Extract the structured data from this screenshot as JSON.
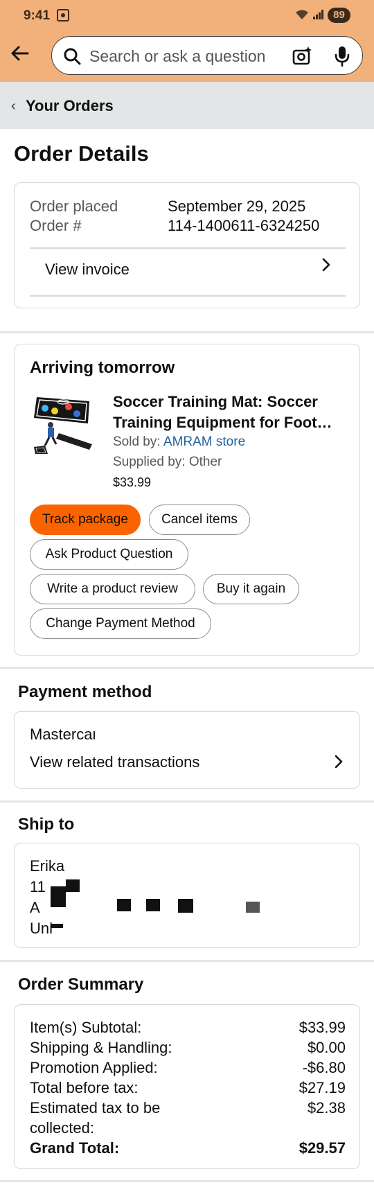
{
  "status_bar": {
    "time": "9:41",
    "battery": "89"
  },
  "search": {
    "placeholder": "Search or ask a question"
  },
  "breadcrumb": {
    "label": "Your Orders"
  },
  "page_title": "Order Details",
  "order_info": {
    "placed_label": "Order placed",
    "placed_value": "September 29, 2025",
    "number_label": "Order #",
    "number_value": "114-1400611-6324250",
    "invoice_label": "View invoice"
  },
  "shipment": {
    "status": "Arriving tomorrow",
    "product_title_line1": "Soccer Training Mat: Soccer",
    "product_title_line2": "Training Equipment for Foot…",
    "sold_by_label": "Sold by: ",
    "sold_by_store": "AMRAM store",
    "supplied_by": "Supplied by: Other",
    "price": "$33.99",
    "actions": {
      "track": "Track package",
      "cancel": "Cancel items",
      "ask": "Ask Product Question",
      "review": "Write a product review",
      "buy_again": "Buy it again",
      "change_payment": "Change Payment Method"
    }
  },
  "payment": {
    "heading": "Payment method",
    "card": "Mastercard",
    "transactions": "View related transactions"
  },
  "ship_to": {
    "heading": "Ship to",
    "line1": "Erika",
    "line2": "11",
    "line3": "A",
    "line4": "Uni"
  },
  "summary": {
    "heading": "Order Summary",
    "rows": [
      {
        "label": "Item(s) Subtotal:",
        "value": "$33.99"
      },
      {
        "label": "Shipping & Handling:",
        "value": "$0.00"
      },
      {
        "label": "Promotion Applied:",
        "value": "-$6.80"
      },
      {
        "label": "Total before tax:",
        "value": "$27.19"
      },
      {
        "label": "Estimated tax to be",
        "label2": "collected:",
        "value": "$2.38"
      },
      {
        "label": "Grand Total:",
        "value": "$29.57"
      }
    ]
  },
  "colors": {
    "header_bg": "#f2b07a",
    "breadcrumb_bg": "#e3e6e6",
    "primary_button": "#fa6400",
    "link": "#2162a1"
  }
}
